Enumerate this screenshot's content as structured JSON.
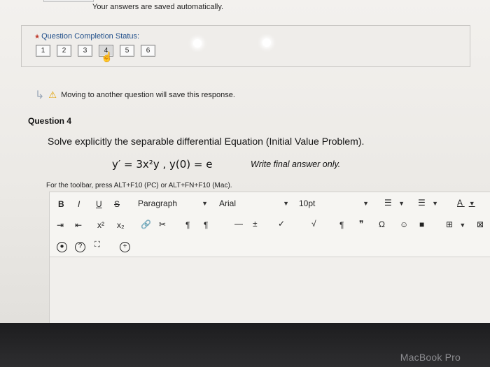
{
  "header": {
    "autosave_text": "Your answers are saved automatically."
  },
  "status": {
    "title": "Question Completion Status:",
    "questions": [
      "1",
      "2",
      "3",
      "4",
      "5",
      "6"
    ],
    "current": "4"
  },
  "notice": {
    "text": "Moving to another question will save this response."
  },
  "question": {
    "title": "Question 4",
    "prompt": "Solve explicitly the separable differential Equation (Initial Value Problem).",
    "equation": "y′ = 3x²y  , y(0) = e",
    "instruction": "Write final answer only."
  },
  "editor": {
    "toolbar_hint": "For the toolbar, press ALT+F10 (PC) or ALT+FN+F10 (Mac).",
    "paragraph": "Paragraph",
    "font": "Arial",
    "size": "10pt",
    "bold": "B",
    "italic": "I",
    "underline": "U",
    "strike": "S",
    "superscript": "x²",
    "subscript": "x₂"
  },
  "device": {
    "brand": "MacBook Pro"
  }
}
